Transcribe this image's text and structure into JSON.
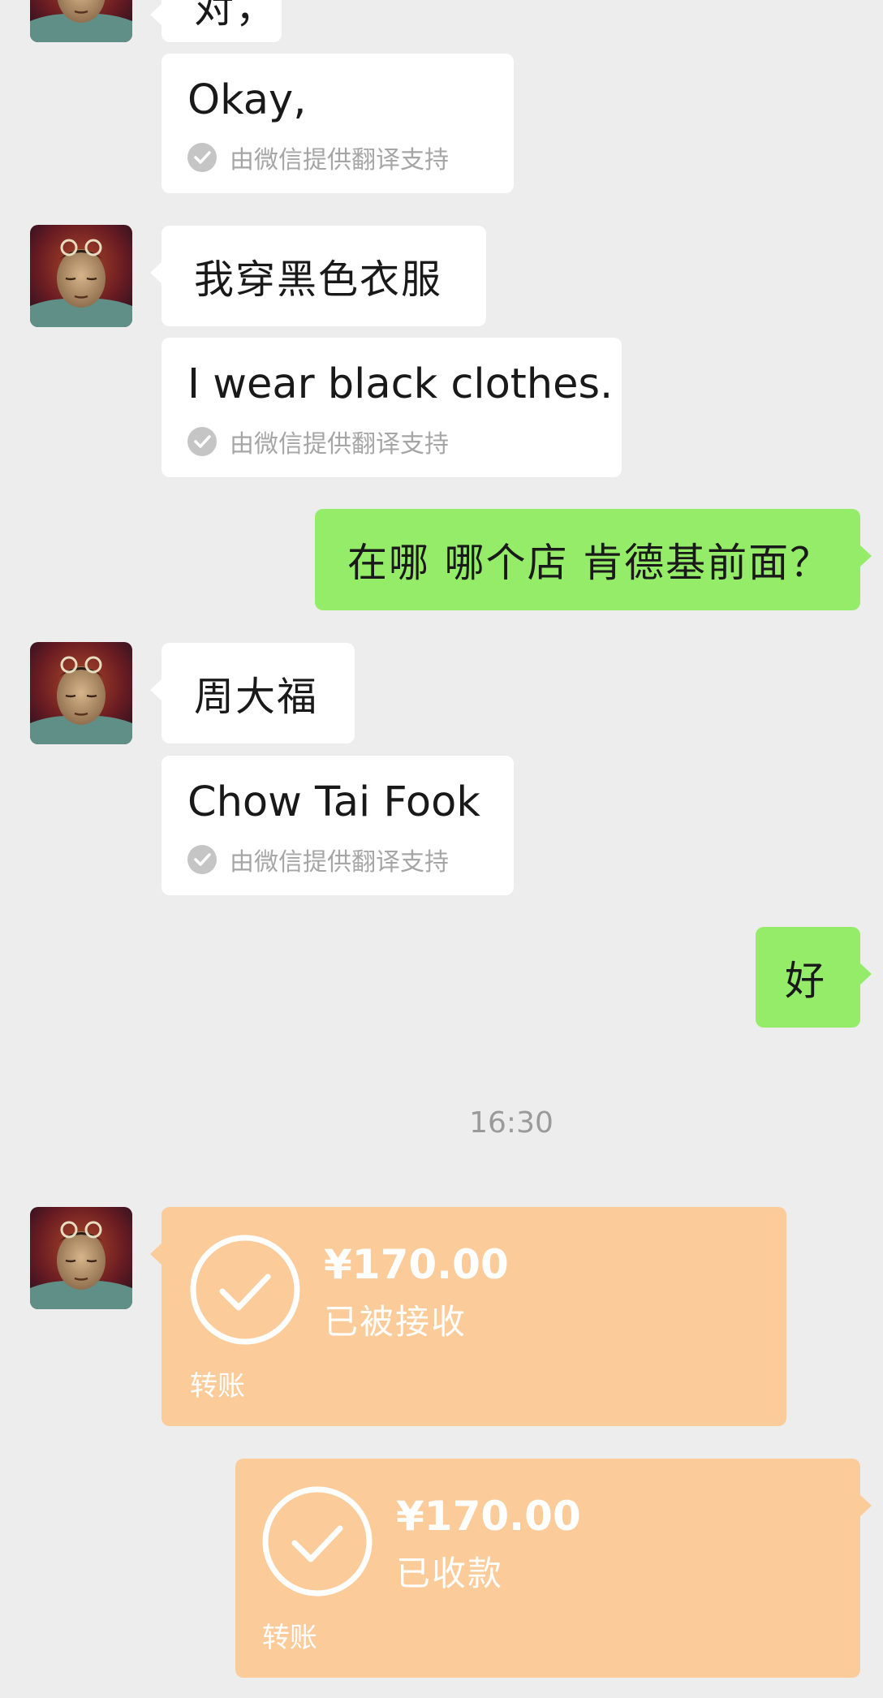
{
  "colors": {
    "background": "#ededed",
    "incoming_bubble": "#ffffff",
    "outgoing_bubble": "#95ec69",
    "transfer_card": "#fbcb9a"
  },
  "messages": [
    {
      "id": "m0",
      "sender": "contact",
      "text": "对，"
    },
    {
      "id": "t0",
      "sender": "contact",
      "translation": "Okay,",
      "note": "由微信提供翻译支持",
      "icon": "check-circle-icon"
    },
    {
      "id": "m1",
      "sender": "contact",
      "text": "我穿黑色衣服"
    },
    {
      "id": "t1",
      "sender": "contact",
      "translation": "I wear black clothes.",
      "note": "由微信提供翻译支持",
      "icon": "check-circle-icon"
    },
    {
      "id": "m2",
      "sender": "me",
      "text": "在哪 哪个店 肯德基前面？"
    },
    {
      "id": "m3",
      "sender": "contact",
      "text": "周大福"
    },
    {
      "id": "t3",
      "sender": "contact",
      "translation": "Chow Tai Fook",
      "note": "由微信提供翻译支持",
      "icon": "check-circle-icon"
    },
    {
      "id": "m4",
      "sender": "me",
      "text": "好"
    }
  ],
  "timestamp": "16:30",
  "transfers": [
    {
      "sender": "contact",
      "amount": "¥170.00",
      "status": "已被接收",
      "kind": "转账",
      "icon": "check-circle-icon"
    },
    {
      "sender": "me",
      "amount": "¥170.00",
      "status": "已收款",
      "kind": "转账",
      "icon": "check-circle-icon"
    }
  ]
}
